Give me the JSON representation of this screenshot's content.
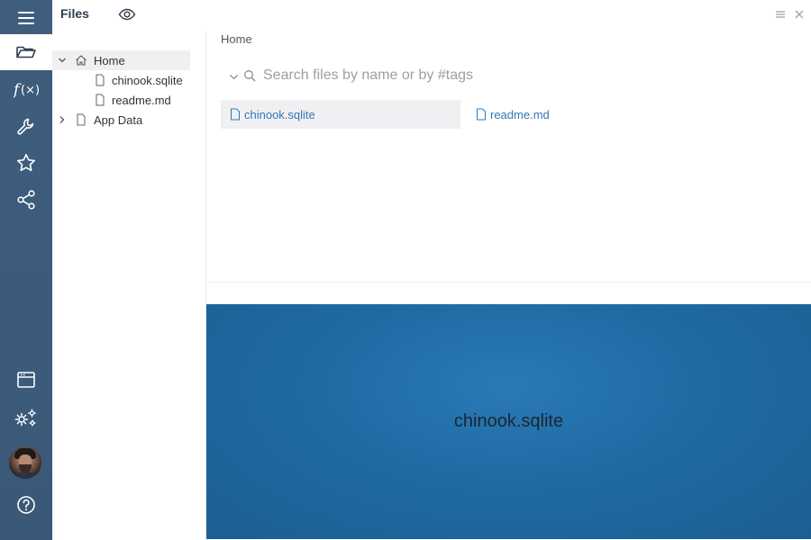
{
  "panel": {
    "title": "Files"
  },
  "rail": {
    "top_items": [
      "menu-icon",
      "folder-open-icon",
      "function-icon",
      "wrench-icon",
      "star-icon",
      "share-icon"
    ],
    "active": "folder-open-icon",
    "bottom_items": [
      "window-icon",
      "settings-icon",
      "avatar",
      "help-icon"
    ]
  },
  "tree": {
    "home": {
      "label": "Home",
      "expanded": true
    },
    "items": [
      {
        "label": "chinook.sqlite"
      },
      {
        "label": "readme.md"
      }
    ],
    "app_data": {
      "label": "App Data",
      "expanded": false
    }
  },
  "main": {
    "breadcrumb": "Home",
    "search_placeholder": "Search files by name or by #tags",
    "files": [
      {
        "label": "chinook.sqlite",
        "selected": true
      },
      {
        "label": "readme.md",
        "selected": false
      }
    ]
  },
  "preview": {
    "name": "chinook.sqlite"
  },
  "colors": {
    "rail": "#3f5d7d",
    "link": "#2f78b8",
    "preview_bg": "#1f6aa3",
    "selection": "#f0f0f3"
  }
}
